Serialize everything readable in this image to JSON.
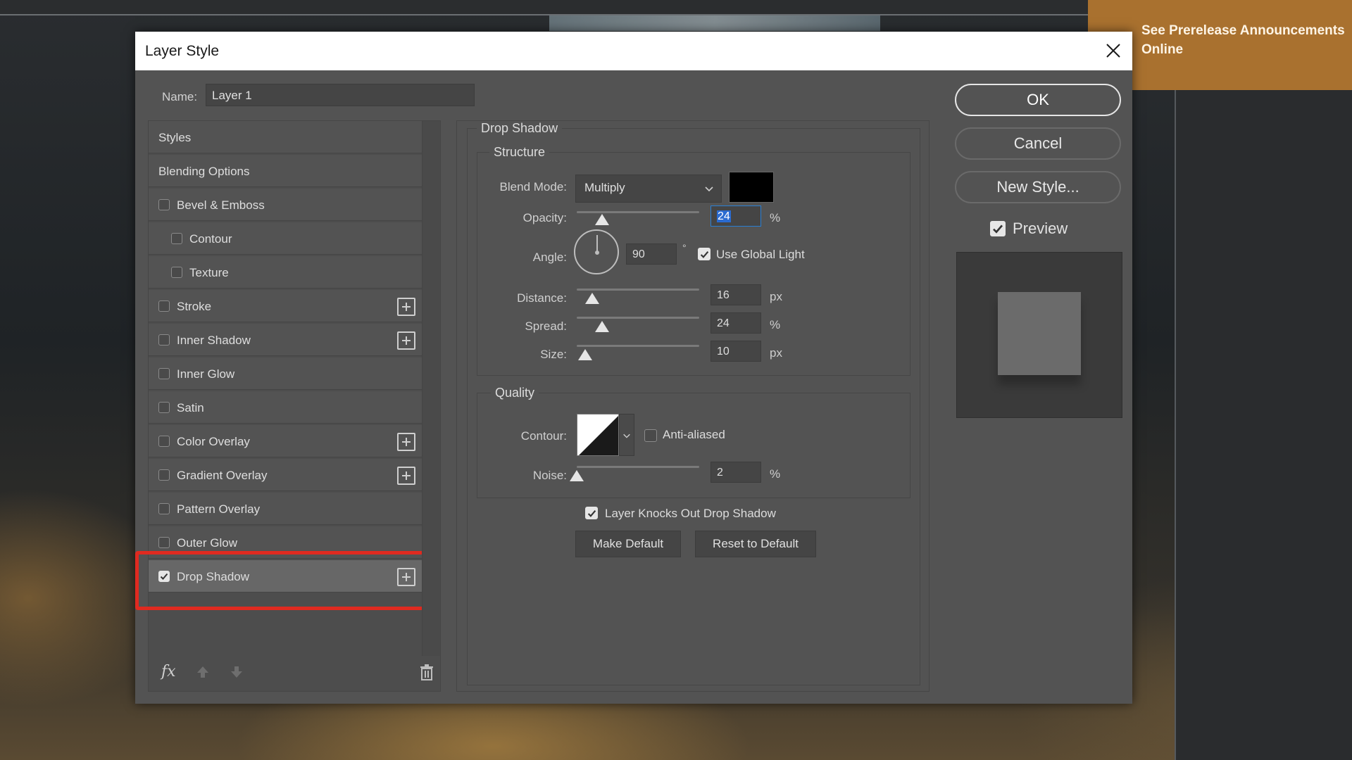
{
  "banner": {
    "text": "See Prerelease Announcements Online"
  },
  "dialog": {
    "title": "Layer Style",
    "close_icon": "close-icon",
    "name_label": "Name:",
    "name_value": "Layer 1"
  },
  "styles_list": {
    "items": [
      {
        "label": "Styles",
        "checkbox": false
      },
      {
        "label": "Blending Options",
        "checkbox": false
      },
      {
        "label": "Bevel & Emboss",
        "checkbox": true,
        "checked": false
      },
      {
        "label": "Contour",
        "checkbox": true,
        "checked": false,
        "indent": true
      },
      {
        "label": "Texture",
        "checkbox": true,
        "checked": false,
        "indent": true
      },
      {
        "label": "Stroke",
        "checkbox": true,
        "checked": false,
        "plus": true
      },
      {
        "label": "Inner Shadow",
        "checkbox": true,
        "checked": false,
        "plus": true
      },
      {
        "label": "Inner Glow",
        "checkbox": true,
        "checked": false
      },
      {
        "label": "Satin",
        "checkbox": true,
        "checked": false
      },
      {
        "label": "Color Overlay",
        "checkbox": true,
        "checked": false,
        "plus": true
      },
      {
        "label": "Gradient Overlay",
        "checkbox": true,
        "checked": false,
        "plus": true
      },
      {
        "label": "Pattern Overlay",
        "checkbox": true,
        "checked": false
      },
      {
        "label": "Outer Glow",
        "checkbox": true,
        "checked": false
      },
      {
        "label": "Drop Shadow",
        "checkbox": true,
        "checked": true,
        "plus": true,
        "selected": true
      }
    ],
    "footer": {
      "fx": "fx",
      "icons": [
        "fx-icon",
        "move-up-icon",
        "move-down-icon",
        "trash-icon"
      ]
    }
  },
  "drop_shadow": {
    "section_title": "Drop Shadow",
    "structure": {
      "title": "Structure",
      "blend_mode_label": "Blend Mode:",
      "blend_mode_value": "Multiply",
      "shadow_color": "#000000",
      "opacity_label": "Opacity:",
      "opacity_value": "24",
      "opacity_unit": "%",
      "angle_label": "Angle:",
      "angle_value": "90",
      "angle_unit": "°",
      "use_global_light_label": "Use Global Light",
      "use_global_light_checked": true,
      "distance_label": "Distance:",
      "distance_value": "16",
      "distance_unit": "px",
      "spread_label": "Spread:",
      "spread_value": "24",
      "spread_unit": "%",
      "size_label": "Size:",
      "size_value": "10",
      "size_unit": "px"
    },
    "quality": {
      "title": "Quality",
      "contour_label": "Contour:",
      "anti_aliased_label": "Anti-aliased",
      "anti_aliased_checked": false,
      "noise_label": "Noise:",
      "noise_value": "2",
      "noise_unit": "%"
    },
    "knockout_label": "Layer Knocks Out Drop Shadow",
    "knockout_checked": true,
    "make_default_label": "Make Default",
    "reset_default_label": "Reset to Default"
  },
  "actions": {
    "ok_label": "OK",
    "cancel_label": "Cancel",
    "new_style_label": "New Style...",
    "preview_label": "Preview",
    "preview_checked": true
  }
}
